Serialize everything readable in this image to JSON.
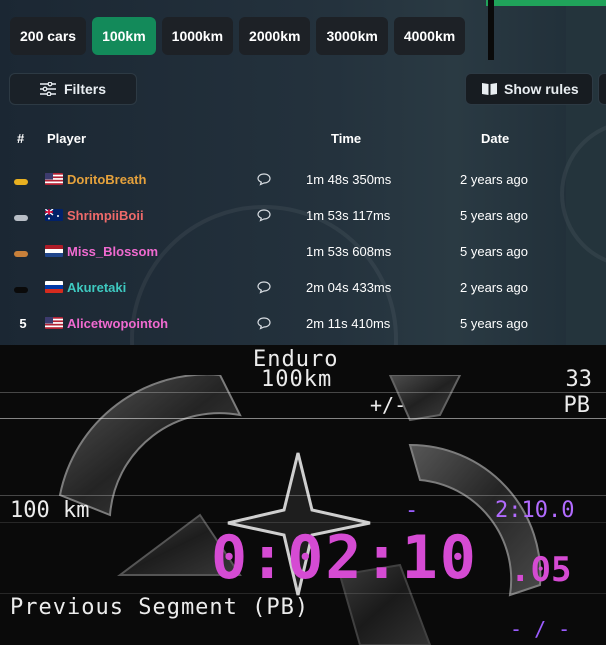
{
  "leaderboard": {
    "tabs": [
      {
        "label": "200 cars",
        "active": false
      },
      {
        "label": "100km",
        "active": true
      },
      {
        "label": "1000km",
        "active": false
      },
      {
        "label": "2000km",
        "active": false
      },
      {
        "label": "3000km",
        "active": false
      },
      {
        "label": "4000km",
        "active": false
      }
    ],
    "filters_label": "Filters",
    "show_rules_label": "Show rules",
    "columns": {
      "rank": "#",
      "player": "Player",
      "time": "Time",
      "date": "Date"
    },
    "rows": [
      {
        "rank": "",
        "medal": "gold",
        "flag": "us",
        "player": "DoritoBreath",
        "color": "#e6a23c",
        "has_comment": true,
        "time": "1m 48s 350ms",
        "date": "2 years ago"
      },
      {
        "rank": "",
        "medal": "silver",
        "flag": "au",
        "player": "ShrimpiiBoii",
        "color": "#ef6a6a",
        "has_comment": true,
        "time": "1m 53s 117ms",
        "date": "5 years ago"
      },
      {
        "rank": "",
        "medal": "bronze",
        "flag": "nl",
        "player": "Miss_Blossom",
        "color": "#f06ad0",
        "has_comment": false,
        "time": "1m 53s 608ms",
        "date": "5 years ago"
      },
      {
        "rank": "",
        "medal": "black",
        "flag": "ru",
        "player": "Akuretaki",
        "color": "#3ec9c0",
        "has_comment": true,
        "time": "2m 04s 433ms",
        "date": "2 years ago"
      },
      {
        "rank": "5",
        "medal": "",
        "flag": "us",
        "player": "Alicetwopointoh",
        "color": "#f06ad0",
        "has_comment": true,
        "time": "2m 11s 410ms",
        "date": "5 years ago"
      }
    ]
  },
  "overlay": {
    "title_line1": "Enduro",
    "title_line2": "100km",
    "attempts": "33",
    "plus_minus": "+/-",
    "pb_label": "PB",
    "segment_name": "100 km",
    "segment_delta": "-",
    "segment_time": "2:10.0",
    "timer_main": "0:02:10",
    "timer_fraction": ".05",
    "previous_segment_label": "Previous Segment (PB)",
    "previous_segment_value": "- / -",
    "colors": {
      "timer": "#d54bd3",
      "delta": "#9b5cff",
      "text": "#ececec"
    }
  }
}
